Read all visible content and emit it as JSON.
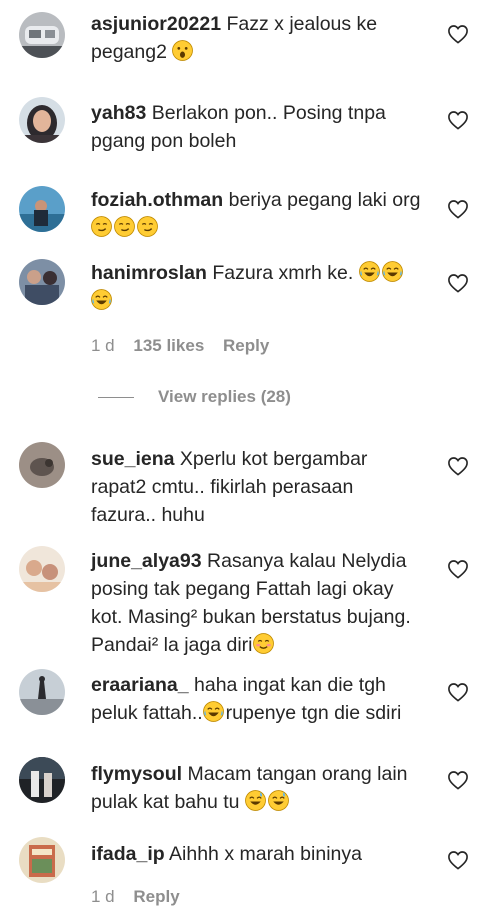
{
  "comments": [
    {
      "username": "asjunior20221",
      "text": "Fazz x jealous ke pegang2",
      "emoji": [
        "astonished"
      ]
    },
    {
      "username": "yah83",
      "text": "Berlakon pon.. Posing tnpa pgang pon boleh"
    },
    {
      "username": "foziah.othman",
      "text": "beriya pegang laki org",
      "emoji": [
        "smirk",
        "smirk",
        "smirk"
      ]
    },
    {
      "username": "hanimroslan",
      "text": "Fazura xmrh ke.",
      "emoji": [
        "joy",
        "joy",
        "joy"
      ],
      "time": "1 d",
      "likes": "135 likes",
      "reply": "Reply"
    },
    {
      "username": "sue_iena",
      "text": "Xperlu kot bergambar rapat2 cmtu.. fikirlah perasaan fazura.. huhu"
    },
    {
      "username": "june_alya93",
      "text": "Rasanya kalau Nelydia posing tak pegang Fattah lagi okay kot. Masing² bukan berstatus bujang. Pandai² la jaga diri",
      "emoji": [
        "blush"
      ]
    },
    {
      "username": "eraariana_",
      "text": "haha ingat kan die tgh peluk fattah..",
      "emoji_mid": "joy",
      "text2": "rupenye tgn die sdiri"
    },
    {
      "username": "flymysoul",
      "text": "Macam tangan orang lain pulak kat bahu tu",
      "emoji": [
        "sweat_smile",
        "sweat_smile"
      ]
    },
    {
      "username": "ifada_ip",
      "text": "Aihhh x marah bininya",
      "time": "1 d",
      "reply": "Reply"
    }
  ],
  "view_replies": "View replies (28)",
  "colors": {
    "text": "#262626",
    "secondary": "#8e8e8e"
  }
}
